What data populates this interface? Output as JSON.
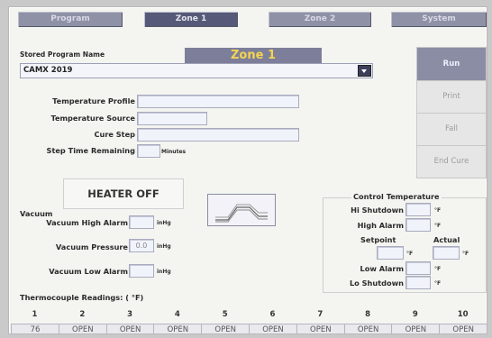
{
  "tabs": [
    "Program",
    "Zone 1",
    "Zone 2",
    "System"
  ],
  "stored_program": {
    "label": "Stored Program Name",
    "zone_title": "Zone 1",
    "selected": "CAMX 2019"
  },
  "side_buttons": [
    "Run",
    "Print",
    "Fall",
    "End Cure"
  ],
  "fields": {
    "temp_profile": "Temperature Profile",
    "temp_source": "Temperature Source",
    "cure_step": "Cure Step",
    "step_time": "Step Time Remaining",
    "minutes": "Minutes"
  },
  "heater_status": "HEATER OFF",
  "vacuum": {
    "title": "Vacuum",
    "high_alarm": "Vacuum High Alarm",
    "pressure": "Vacuum Pressure",
    "pressure_value": "0.0",
    "low_alarm": "Vacuum Low Alarm",
    "unit": "inHg"
  },
  "control": {
    "title": "Control Temperature",
    "hi_shutdown": "Hi Shutdown",
    "high_alarm": "High Alarm",
    "setpoint": "Setpoint",
    "actual": "Actual",
    "low_alarm": "Low Alarm",
    "lo_shutdown": "Lo Shutdown",
    "unit": "°F"
  },
  "thermocouple": {
    "title": "Thermocouple Readings:  ( °F)",
    "numbers": [
      "1",
      "2",
      "3",
      "4",
      "5",
      "6",
      "7",
      "8",
      "9",
      "10"
    ],
    "values": [
      "76",
      "OPEN",
      "OPEN",
      "OPEN",
      "OPEN",
      "OPEN",
      "OPEN",
      "OPEN",
      "OPEN",
      "OPEN"
    ]
  },
  "colors": {
    "tab_bg": "#8f91a6",
    "tab_active": "#565a78",
    "zone_text": "#f4d451",
    "panel": "#f4f4f1"
  }
}
